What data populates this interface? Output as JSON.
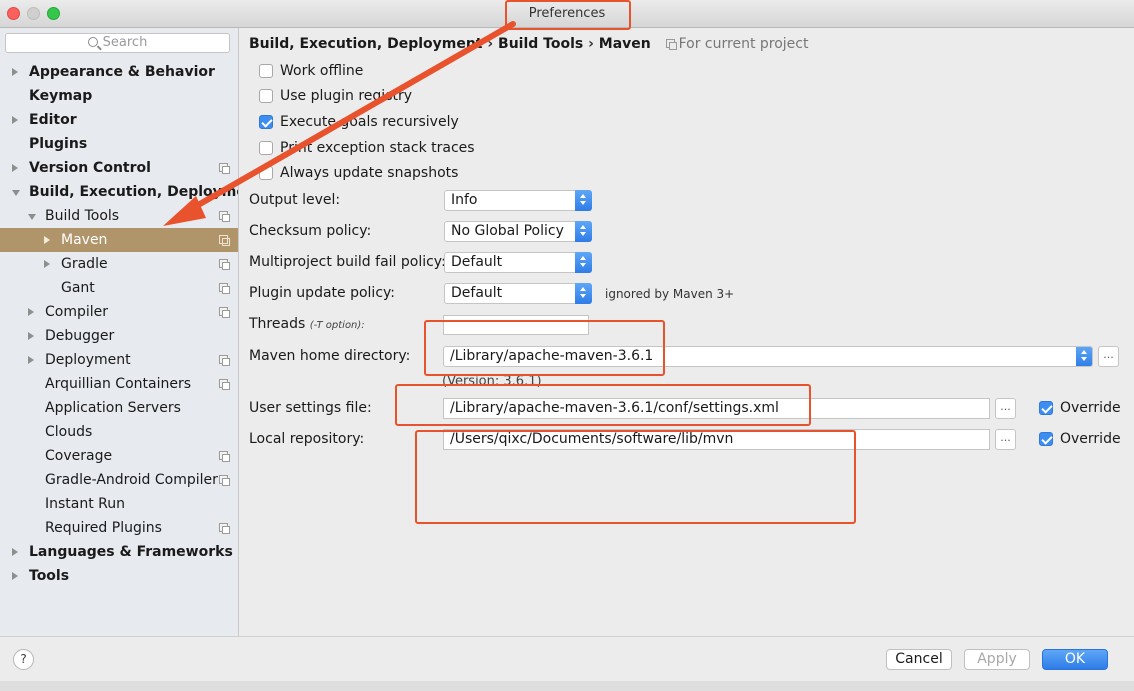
{
  "window": {
    "title": "Preferences"
  },
  "sidebar": {
    "search_placeholder": "Search",
    "items": [
      {
        "label": "Appearance & Behavior",
        "bold": true,
        "indent": 0,
        "arrow": "right",
        "proj": false
      },
      {
        "label": "Keymap",
        "bold": true,
        "indent": 0,
        "arrow": "",
        "proj": false
      },
      {
        "label": "Editor",
        "bold": true,
        "indent": 0,
        "arrow": "right",
        "proj": false
      },
      {
        "label": "Plugins",
        "bold": true,
        "indent": 0,
        "arrow": "",
        "proj": false
      },
      {
        "label": "Version Control",
        "bold": true,
        "indent": 0,
        "arrow": "right",
        "proj": true
      },
      {
        "label": "Build, Execution, Deployment",
        "bold": true,
        "indent": 0,
        "arrow": "down",
        "proj": false
      },
      {
        "label": "Build Tools",
        "bold": false,
        "indent": 1,
        "arrow": "down",
        "proj": true
      },
      {
        "label": "Maven",
        "bold": false,
        "indent": 2,
        "arrow": "right",
        "proj": true,
        "selected": true
      },
      {
        "label": "Gradle",
        "bold": false,
        "indent": 2,
        "arrow": "right",
        "proj": true
      },
      {
        "label": "Gant",
        "bold": false,
        "indent": 2,
        "arrow": "",
        "proj": true
      },
      {
        "label": "Compiler",
        "bold": false,
        "indent": 1,
        "arrow": "right",
        "proj": true
      },
      {
        "label": "Debugger",
        "bold": false,
        "indent": 1,
        "arrow": "right",
        "proj": false
      },
      {
        "label": "Deployment",
        "bold": false,
        "indent": 1,
        "arrow": "right",
        "proj": true
      },
      {
        "label": "Arquillian Containers",
        "bold": false,
        "indent": 1,
        "arrow": "",
        "proj": true
      },
      {
        "label": "Application Servers",
        "bold": false,
        "indent": 1,
        "arrow": "",
        "proj": false
      },
      {
        "label": "Clouds",
        "bold": false,
        "indent": 1,
        "arrow": "",
        "proj": false
      },
      {
        "label": "Coverage",
        "bold": false,
        "indent": 1,
        "arrow": "",
        "proj": true
      },
      {
        "label": "Gradle-Android Compiler",
        "bold": false,
        "indent": 1,
        "arrow": "",
        "proj": true
      },
      {
        "label": "Instant Run",
        "bold": false,
        "indent": 1,
        "arrow": "",
        "proj": false
      },
      {
        "label": "Required Plugins",
        "bold": false,
        "indent": 1,
        "arrow": "",
        "proj": true
      },
      {
        "label": "Languages & Frameworks",
        "bold": true,
        "indent": 0,
        "arrow": "right",
        "proj": false
      },
      {
        "label": "Tools",
        "bold": true,
        "indent": 0,
        "arrow": "right",
        "proj": false
      }
    ]
  },
  "breadcrumb": {
    "part1": "Build, Execution, Deployment",
    "sep": "›",
    "part2": "Build Tools",
    "part3": "Maven",
    "for_project": "For current project"
  },
  "checkboxes": {
    "work_offline": {
      "label": "Work offline",
      "checked": false
    },
    "plugin_registry": {
      "label": "Use plugin registry",
      "checked": false
    },
    "recursive": {
      "label": "Execute goals recursively",
      "checked": true
    },
    "stack_traces": {
      "label": "Print exception stack traces",
      "checked": false
    },
    "snapshots": {
      "label": "Always update snapshots",
      "checked": false
    }
  },
  "fields": {
    "output_level": {
      "label": "Output level:",
      "value": "Info"
    },
    "checksum": {
      "label": "Checksum policy:",
      "value": "No Global Policy"
    },
    "fail_policy": {
      "label": "Multiproject build fail policy:",
      "value": "Default"
    },
    "plugin_update": {
      "label": "Plugin update policy:",
      "value": "Default",
      "note": "ignored by Maven 3+"
    },
    "threads": {
      "label": "Threads",
      "hint": "(-T option):",
      "value": ""
    },
    "maven_home": {
      "label": "Maven home directory:",
      "value": "/Library/apache-maven-3.6.1",
      "version": "(Version: 3.6.1)"
    },
    "user_settings": {
      "label": "User settings file:",
      "value": "/Library/apache-maven-3.6.1/conf/settings.xml",
      "override": "Override"
    },
    "local_repo": {
      "label": "Local repository:",
      "value": "/Users/qixc/Documents/software/lib/mvn",
      "override": "Override"
    },
    "browse": "..."
  },
  "buttons": {
    "help": "?",
    "cancel": "Cancel",
    "apply": "Apply",
    "ok": "OK"
  },
  "colors": {
    "selection": "#b0956a",
    "accent": "#3d8ef0",
    "annotation": "#e8532d"
  }
}
